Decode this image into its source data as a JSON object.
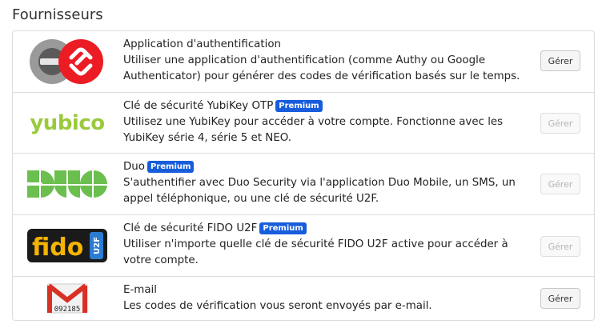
{
  "section": {
    "title": "Fournisseurs"
  },
  "providers": [
    {
      "name": "Application d'authentification",
      "premium": false,
      "description": "Utiliser une application d'authentification (comme Authy ou Google Authenticator) pour générer des codes de vérification basés sur le temps.",
      "logo_icon": "authenticator-app-icon",
      "button": "Gérer",
      "enabled": true
    },
    {
      "name": "Clé de sécurité YubiKey OTP",
      "premium": true,
      "description": "Utilisez une YubiKey pour accéder à votre compte. Fonctionne avec les YubiKey série 4, série 5 et NEO.",
      "logo_icon": "yubico-logo",
      "logo_text": "yubico",
      "button": "Gérer",
      "enabled": false
    },
    {
      "name": "Duo",
      "premium": true,
      "description": "S'authentifier avec Duo Security via l'application Duo Mobile, un SMS, un appel téléphonique, ou une clé de sécurité U2F.",
      "logo_icon": "duo-logo",
      "button": "Gérer",
      "enabled": false
    },
    {
      "name": "Clé de sécurité FIDO U2F",
      "premium": true,
      "description": "Utiliser n'importe quelle clé de sécurité FIDO U2F active pour accéder à votre compte.",
      "logo_icon": "fido-u2f-logo",
      "button": "Gérer",
      "enabled": false
    },
    {
      "name": "E-mail",
      "premium": false,
      "description": "Les codes de vérification vous seront envoyés par e-mail.",
      "logo_icon": "gmail-envelope-icon",
      "logo_code": "092185",
      "button": "Gérer",
      "enabled": true
    }
  ],
  "badge_label": "Premium",
  "colors": {
    "badge": "#175ddc",
    "yubico_green": "#9aca3c",
    "duo_green": "#6bbf4e",
    "authy_red": "#ec1c24",
    "gmail_red": "#d93025"
  }
}
